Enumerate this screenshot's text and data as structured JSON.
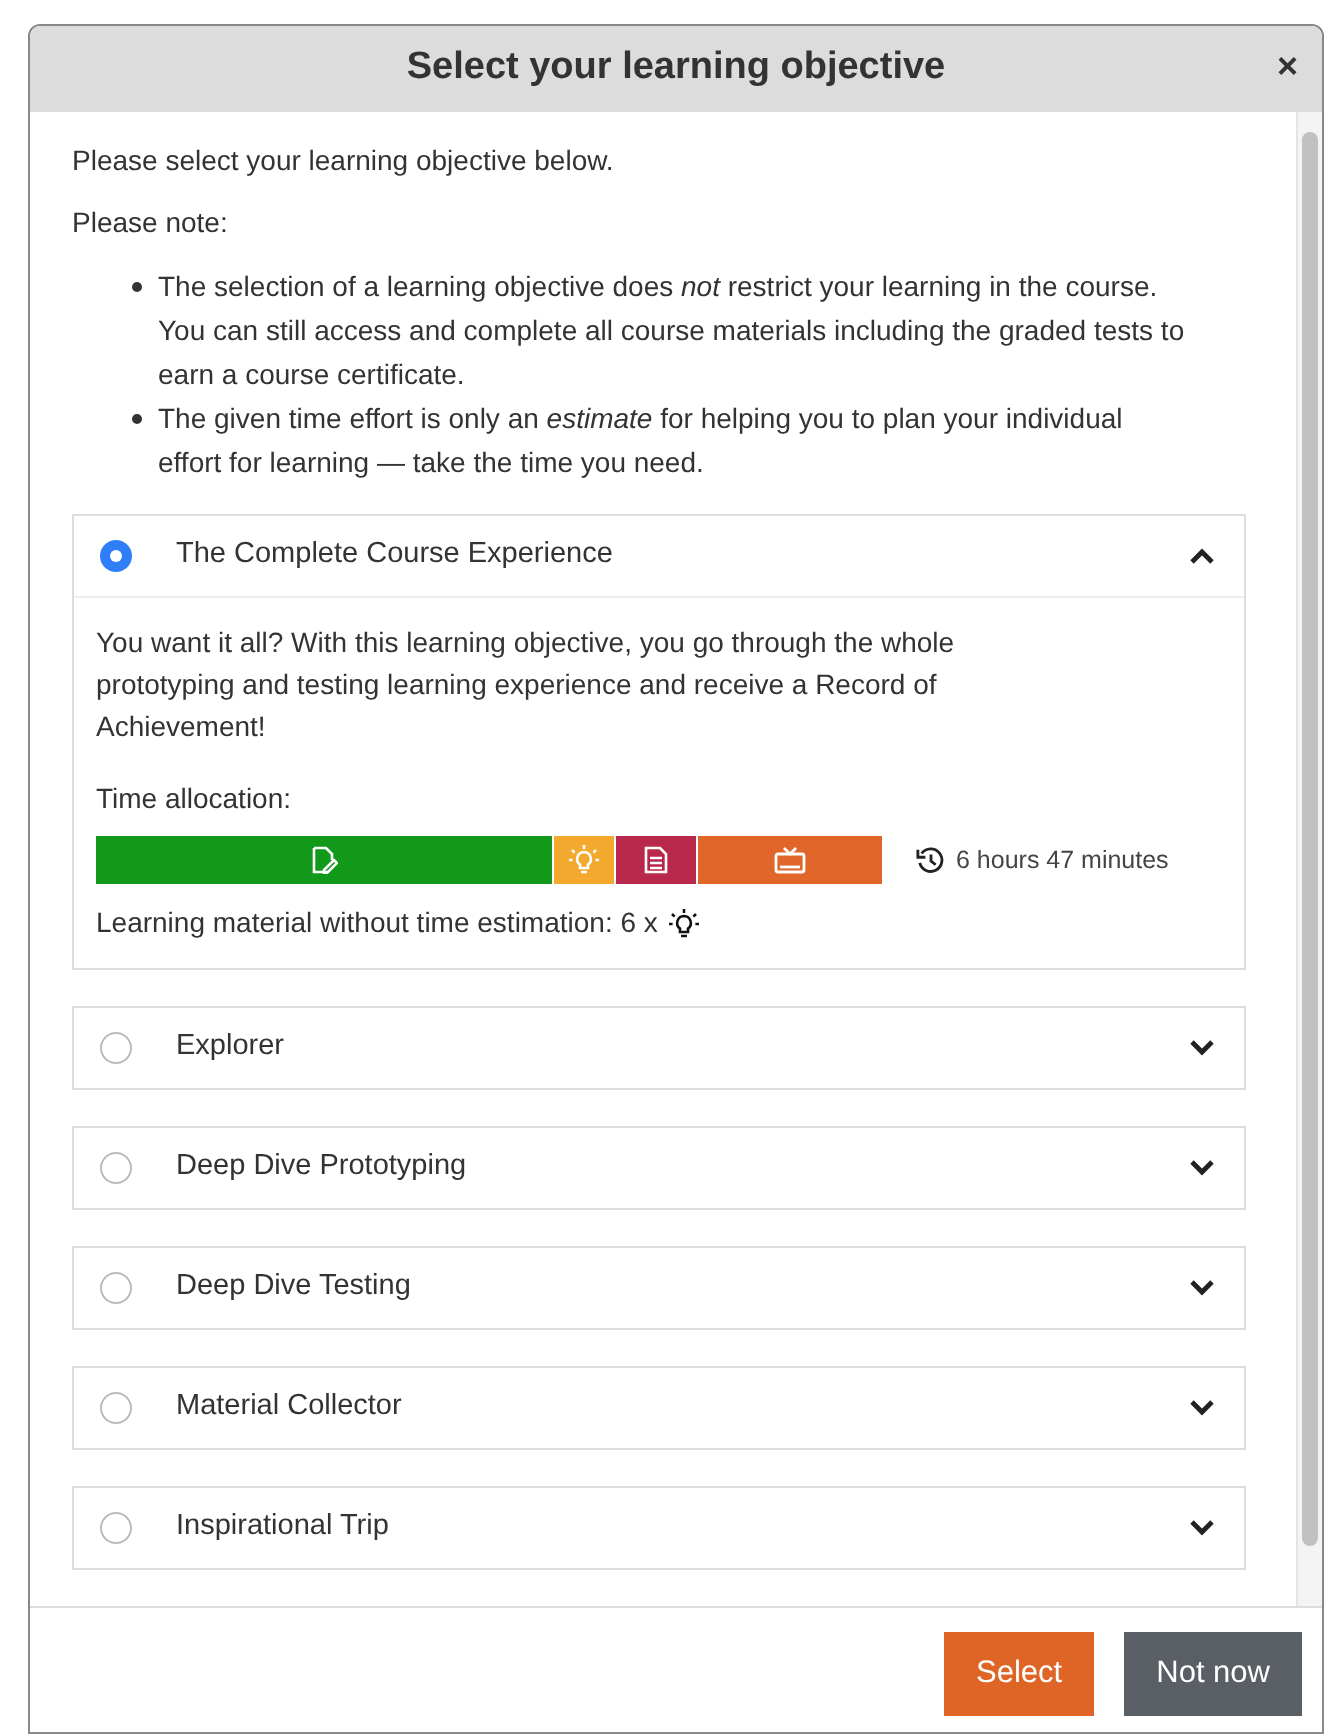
{
  "dialog": {
    "title": "Select your learning objective",
    "close": "×"
  },
  "intro": "Please select your learning objective below.",
  "note_label": "Please note:",
  "notes": [
    "The selection of a learning objective does *not* restrict your learning in the course. You can still access and complete all course materials including the graded tests to earn a course certificate.",
    "The given time effort is only an *estimate* for helping you to plan your individual effort for learning — take the time you need."
  ],
  "objectives": [
    {
      "title": "The Complete Course Experience",
      "selected": true,
      "expanded": true,
      "description": "You want it all? With this learning objective, you go through the whole prototyping and testing learning experience and receive a Record of Achievement!",
      "time_label": "Time allocation:",
      "segments": [
        {
          "kind": "exercise",
          "color": "#12991a"
        },
        {
          "kind": "idea",
          "color": "#f2a92e"
        },
        {
          "kind": "document",
          "color": "#b7284a"
        },
        {
          "kind": "video",
          "color": "#e0662a"
        }
      ],
      "total": "6 hours 47 minutes",
      "untimed": "Learning material without time estimation: 6 x"
    },
    {
      "title": "Explorer",
      "selected": false,
      "expanded": false
    },
    {
      "title": "Deep Dive Prototyping",
      "selected": false,
      "expanded": false
    },
    {
      "title": "Deep Dive Testing",
      "selected": false,
      "expanded": false
    },
    {
      "title": "Material Collector",
      "selected": false,
      "expanded": false
    },
    {
      "title": "Inspirational Trip",
      "selected": false,
      "expanded": false
    }
  ],
  "buttons": [
    {
      "label": "Select",
      "kind": "primary"
    },
    {
      "label": "Not now",
      "kind": "secondary"
    }
  ]
}
